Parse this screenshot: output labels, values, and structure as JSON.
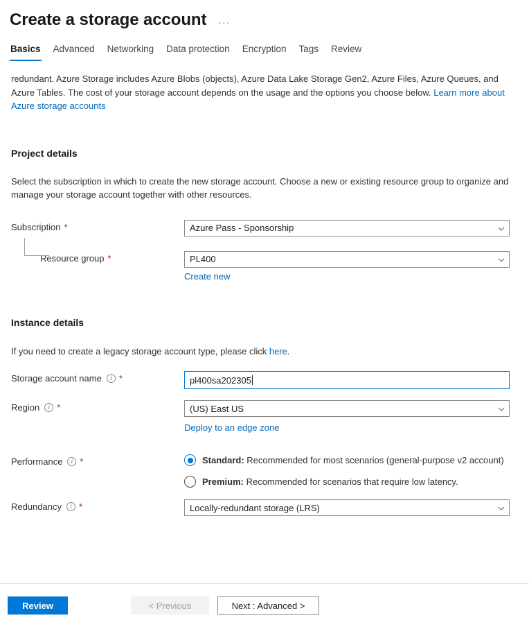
{
  "header": {
    "title": "Create a storage account",
    "more_label": "···"
  },
  "tabs": [
    {
      "label": "Basics",
      "active": true
    },
    {
      "label": "Advanced",
      "active": false
    },
    {
      "label": "Networking",
      "active": false
    },
    {
      "label": "Data protection",
      "active": false
    },
    {
      "label": "Encryption",
      "active": false
    },
    {
      "label": "Tags",
      "active": false
    },
    {
      "label": "Review",
      "active": false
    }
  ],
  "intro": {
    "text": "redundant. Azure Storage includes Azure Blobs (objects), Azure Data Lake Storage Gen2, Azure Files, Azure Queues, and Azure Tables. The cost of your storage account depends on the usage and the options you choose below. ",
    "link_label": "Learn more about Azure storage accounts"
  },
  "project_details": {
    "heading": "Project details",
    "description": "Select the subscription in which to create the new storage account. Choose a new or existing resource group to organize and manage your storage account together with other resources.",
    "subscription": {
      "label": "Subscription",
      "required": "*",
      "value": "Azure Pass - Sponsorship"
    },
    "resource_group": {
      "label": "Resource group",
      "required": "*",
      "value": "PL400",
      "create_new_label": "Create new"
    }
  },
  "instance_details": {
    "heading": "Instance details",
    "legacy_note_before": "If you need to create a legacy storage account type, please click ",
    "legacy_note_link": "here",
    "legacy_note_after": ".",
    "storage_account_name": {
      "label": "Storage account name",
      "required": "*",
      "value": "pl400sa202305"
    },
    "region": {
      "label": "Region",
      "required": "*",
      "value": "(US) East US",
      "edge_zone_link": "Deploy to an edge zone"
    },
    "performance": {
      "label": "Performance",
      "required": "*",
      "options": [
        {
          "bold": "Standard:",
          "text": " Recommended for most scenarios (general-purpose v2 account)",
          "selected": true
        },
        {
          "bold": "Premium:",
          "text": " Recommended for scenarios that require low latency.",
          "selected": false
        }
      ]
    },
    "redundancy": {
      "label": "Redundancy",
      "required": "*",
      "value": "Locally-redundant storage (LRS)"
    }
  },
  "footer": {
    "review_label": "Review",
    "previous_label": "< Previous",
    "next_label": "Next : Advanced >"
  },
  "colors": {
    "accent": "#0078d4",
    "link": "#0067b8",
    "required": "#a4262c",
    "border": "#8a8886"
  }
}
